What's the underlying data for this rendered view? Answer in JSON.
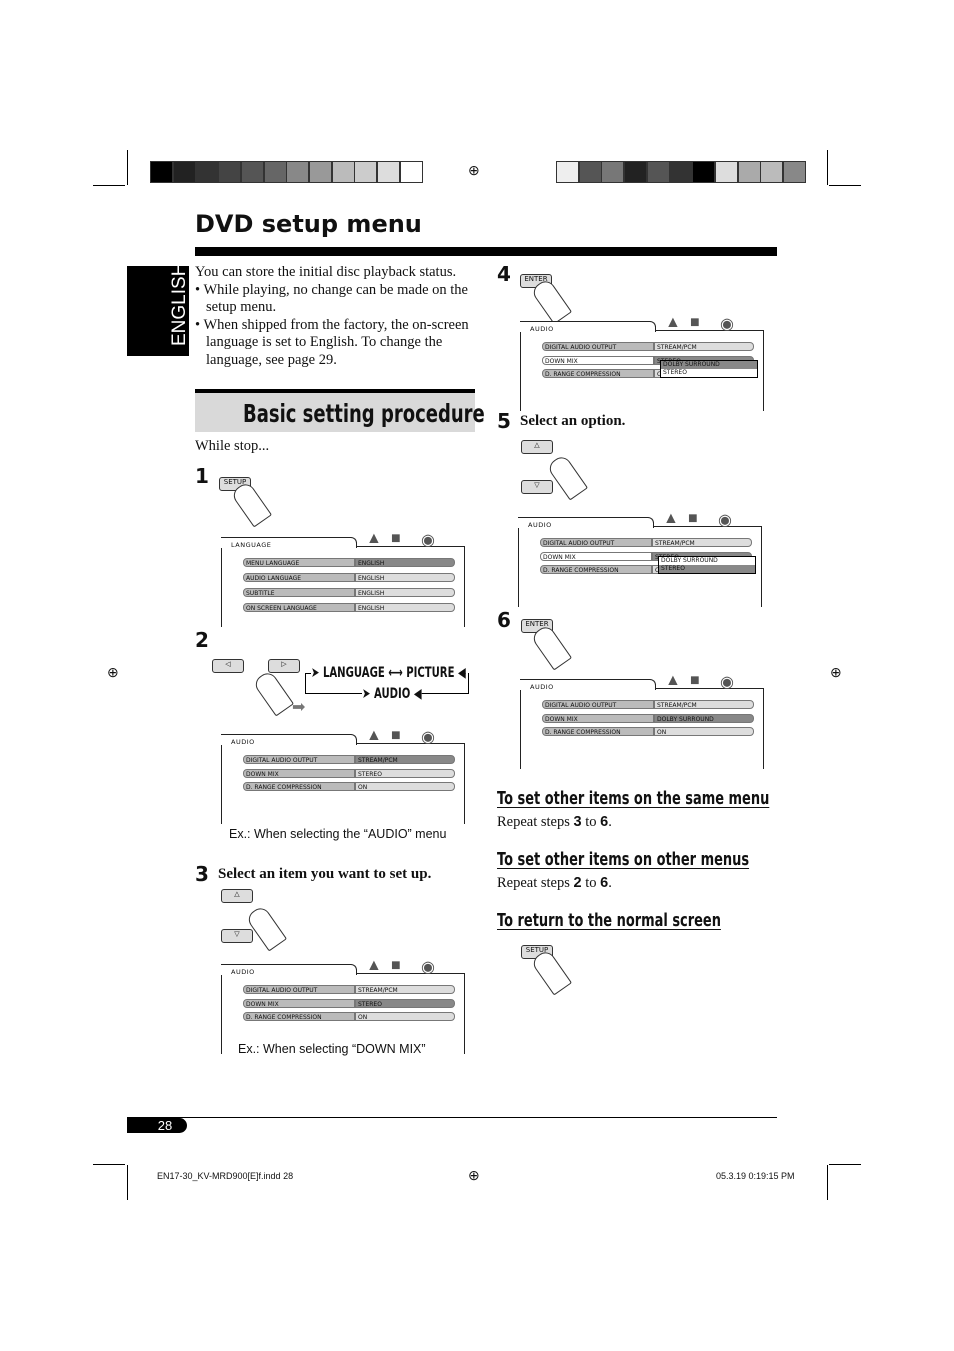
{
  "header": {
    "title": "DVD setup menu",
    "language_tab": "ENGLISH"
  },
  "colors": {
    "bar": "#000000",
    "banner": "#d9d9d9"
  },
  "swatches_left": [
    "#000",
    "#222",
    "#333",
    "#444",
    "#555",
    "#666",
    "#888",
    "#999",
    "#bbb",
    "#ccc",
    "#ddd",
    "#fff"
  ],
  "swatches_right": [
    "#eee",
    "#555",
    "#777",
    "#222",
    "#555",
    "#333",
    "#000",
    "#ddd",
    "#aaa",
    "#bbb",
    "#888"
  ],
  "intro": {
    "text": "You can store the initial disc playback status.",
    "bullets": [
      "While playing, no change can be made on the setup menu.",
      "When shipped from the factory, the on-screen language is set to English. To change the language, see page 29."
    ]
  },
  "procedure": {
    "banner": "Basic setting procedure",
    "while_stop": "While stop..."
  },
  "steps": {
    "s1": {
      "num": "1",
      "button": "SETUP"
    },
    "s2": {
      "num": "2",
      "flow": {
        "language": "LANGUAGE",
        "picture": "PICTURE",
        "audio": "AUDIO"
      },
      "caption": "Ex.: When selecting the “AUDIO” menu"
    },
    "s3": {
      "num": "3",
      "text": "Select an item you want to set up.",
      "caption": "Ex.: When selecting “DOWN MIX”"
    },
    "s4": {
      "num": "4",
      "button": "ENTER"
    },
    "s5": {
      "num": "5",
      "text": "Select an option."
    },
    "s6": {
      "num": "6",
      "button": "ENTER"
    }
  },
  "screens": [
    {
      "tab": "LANGUAGE",
      "rows": [
        [
          "MENU LANGUAGE",
          "ENGLISH",
          "",
          "dark"
        ],
        [
          "AUDIO LANGUAGE",
          "ENGLISH",
          "",
          ""
        ],
        [
          "SUBTITLE",
          "ENGLISH",
          "",
          ""
        ],
        [
          "ON SCREEN LANGUAGE",
          "ENGLISH",
          "",
          ""
        ]
      ]
    },
    {
      "tab": "AUDIO",
      "rows": [
        [
          "DIGITAL AUDIO OUTPUT",
          "STREAM/PCM",
          "",
          "dark"
        ],
        [
          "DOWN MIX",
          "STEREO",
          "",
          ""
        ],
        [
          "D. RANGE COMPRESSION",
          "ON",
          "",
          ""
        ]
      ]
    },
    {
      "tab": "AUDIO",
      "rows": [
        [
          "DIGITAL AUDIO OUTPUT",
          "STREAM/PCM",
          "",
          ""
        ],
        [
          "DOWN MIX",
          "STEREO",
          "",
          "dark"
        ],
        [
          "D. RANGE COMPRESSION",
          "ON",
          "",
          ""
        ]
      ]
    },
    {
      "tab": "AUDIO",
      "rows": [
        [
          "DIGITAL AUDIO OUTPUT",
          "STREAM/PCM",
          "",
          ""
        ],
        [
          "DOWN MIX",
          "STEREO",
          "white",
          "dark"
        ],
        [
          "D. RANGE COMPRESSION",
          "ON",
          "",
          ""
        ]
      ],
      "popup": [
        "DOLBY SURROUND",
        "STEREO"
      ],
      "popup_hl": 0
    },
    {
      "tab": "AUDIO",
      "rows": [
        [
          "DIGITAL AUDIO OUTPUT",
          "STREAM/PCM",
          "",
          ""
        ],
        [
          "DOWN MIX",
          "STEREO",
          "white",
          "dark"
        ],
        [
          "D. RANGE COMPRESSION",
          "ON",
          "",
          ""
        ]
      ],
      "popup": [
        "DOLBY SURROUND",
        "STEREO"
      ],
      "popup_hl": 1
    },
    {
      "tab": "AUDIO",
      "rows": [
        [
          "DIGITAL AUDIO OUTPUT",
          "STREAM/PCM",
          "",
          ""
        ],
        [
          "DOWN MIX",
          "DOLBY SURROUND",
          "",
          "dark"
        ],
        [
          "D. RANGE COMPRESSION",
          "ON",
          "",
          ""
        ]
      ]
    }
  ],
  "right": {
    "same_menu": {
      "title": "To set other items on the same menu",
      "text": "Repeat steps ",
      "from": "3",
      "to_word": " to ",
      "to": "6",
      "end": "."
    },
    "other_menus": {
      "title": "To set other items on other menus",
      "text": "Repeat steps ",
      "from": "2",
      "to_word": " to ",
      "to": "6",
      "end": "."
    },
    "normal": {
      "title": "To return to the normal screen",
      "button": "SETUP"
    }
  },
  "footer": {
    "page": "28",
    "file": "EN17-30_KV-MRD900[E]f.indd   28",
    "date": "05.3.19   0:19:15 PM"
  }
}
